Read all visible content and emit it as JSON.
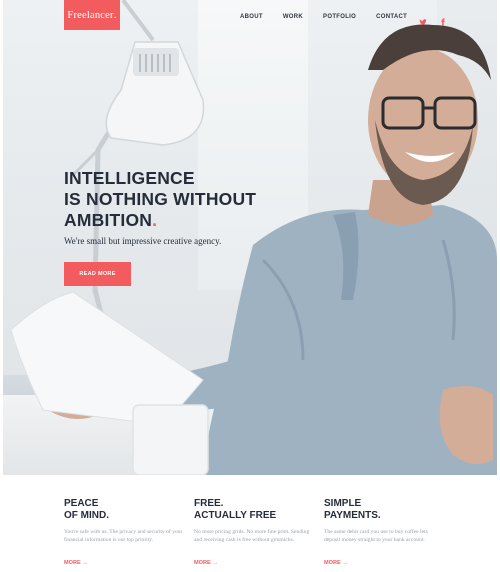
{
  "brand": {
    "logo_text": "Freelancer",
    "logo_dot": ".",
    "accent": "#f25c5f",
    "ink": "#262d3a"
  },
  "nav": {
    "items": [
      {
        "label": "ABOUT"
      },
      {
        "label": "WORK"
      },
      {
        "label": "POTFOLIO"
      },
      {
        "label": "CONTACT"
      }
    ],
    "social": [
      {
        "icon": "twitter-icon"
      },
      {
        "icon": "facebook-icon"
      }
    ]
  },
  "hero": {
    "headline": [
      "INTELLIGENCE",
      "IS NOTHING WITHOUT",
      "AMBITION"
    ],
    "headline_dot": ".",
    "subline": "We're small but impressive creative agency.",
    "cta_label": "READ MORE"
  },
  "features": [
    {
      "title": [
        "PEACE",
        "OF MIND."
      ],
      "body": "You're safe with us. The privacy and security of your financial information is our top priority.",
      "more": "MORE →"
    },
    {
      "title": [
        "FREE.",
        "ACTUALLY FREE"
      ],
      "body": "No more pricing grids. No more fine print. Sending and receiving cash is free without gimmicks.",
      "more": "MORE →"
    },
    {
      "title": [
        "SIMPLE",
        "PAYMENTS."
      ],
      "body": "The same debit card you use to buy coffee lets deposit money straight to your bank account.",
      "more": "MORE →"
    }
  ]
}
